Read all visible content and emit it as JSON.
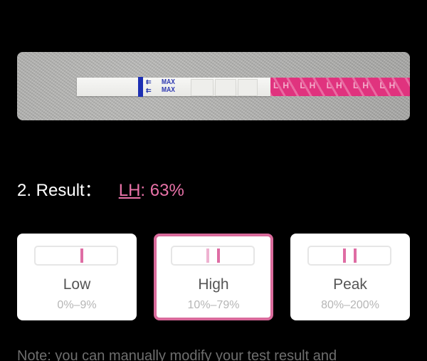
{
  "photo": {
    "strip_blue_text": "MAX",
    "strip_pink_text": "LH LH LH LH LH"
  },
  "result": {
    "label": "2. Result：",
    "hormone": "LH",
    "value": ": 63%"
  },
  "cards": [
    {
      "title": "Low",
      "range": "0%–9%",
      "selected": false
    },
    {
      "title": "High",
      "range": "10%–79%",
      "selected": true
    },
    {
      "title": "Peak",
      "range": "80%–200%",
      "selected": false
    }
  ],
  "note": "Note: you can manually modify your test result and",
  "colors": {
    "accent": "#e872a8",
    "selected_border": "#d96a9b",
    "strip_pink": "#e0337e",
    "background": "#000000"
  }
}
